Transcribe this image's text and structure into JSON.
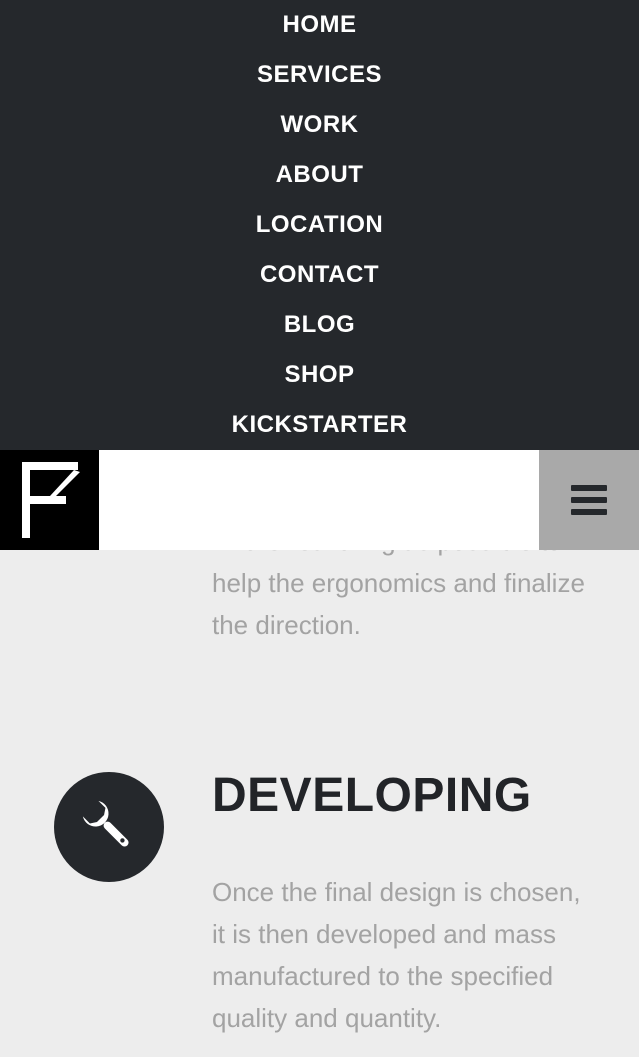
{
  "menu": {
    "items": [
      {
        "label": "HOME"
      },
      {
        "label": "SERVICES"
      },
      {
        "label": "WORK"
      },
      {
        "label": "ABOUT"
      },
      {
        "label": "LOCATION"
      },
      {
        "label": "CONTACT"
      },
      {
        "label": "BLOG"
      },
      {
        "label": "SHOP"
      },
      {
        "label": "KICKSTARTER"
      }
    ]
  },
  "header": {
    "logo_icon": "fk-logo",
    "menu_icon": "hamburger-icon"
  },
  "sections": {
    "prototyping": {
      "text": "… the real thing as possible to help the ergonomics and finalize the direction."
    },
    "developing": {
      "icon": "wrench-icon",
      "title": "DEVELOPING",
      "text": "Once the final design is chosen, it is then developed and mass manufactured to the specified quality and quantity."
    }
  },
  "colors": {
    "menu_bg": "#25282c",
    "page_bg": "#ededed",
    "text_muted": "#a3a3a3",
    "heading": "#222428",
    "hamburger_bg": "#a9a9a9"
  }
}
